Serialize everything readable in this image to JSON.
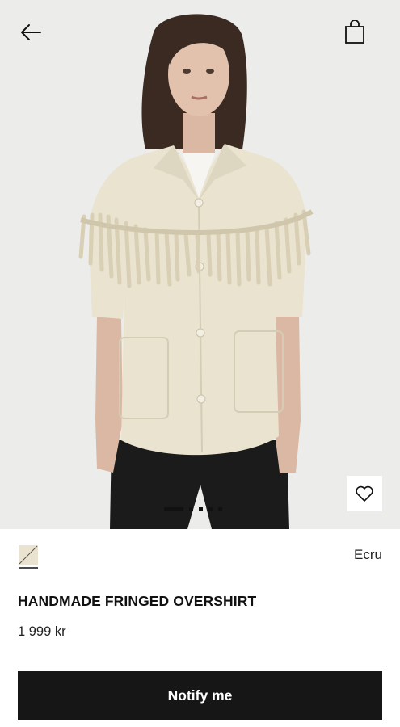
{
  "icons": {
    "back": "arrow-left-icon",
    "bag": "shopping-bag-icon",
    "favorite": "heart-icon",
    "swatch": "color-swatch-icon"
  },
  "gallery": {
    "page_count": 5,
    "active_page": 1
  },
  "product": {
    "color_name": "Ecru",
    "title": "HANDMADE FRINGED OVERSHIRT",
    "price": "1 999 kr"
  },
  "actions": {
    "notify_label": "Notify me"
  },
  "colors": {
    "background": "#ffffff",
    "photo_background": "#ececea",
    "jacket": "#e9e3cf",
    "button": "#161616",
    "text": "#111111"
  }
}
